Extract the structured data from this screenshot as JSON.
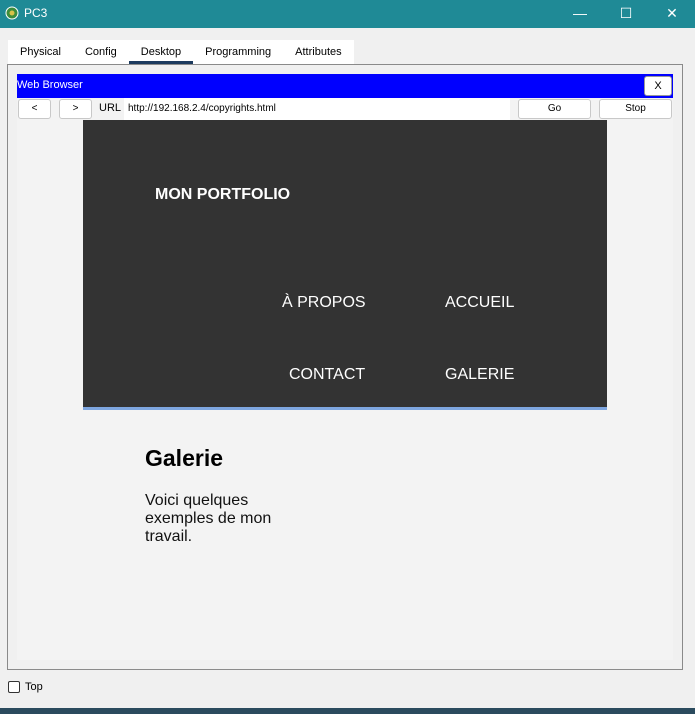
{
  "window": {
    "title": "PC3",
    "min_glyph": "—",
    "max_glyph": "☐",
    "close_glyph": "✕"
  },
  "tabs": [
    {
      "label": "Physical",
      "active": false
    },
    {
      "label": "Config",
      "active": false
    },
    {
      "label": "Desktop",
      "active": true
    },
    {
      "label": "Programming",
      "active": false
    },
    {
      "label": "Attributes",
      "active": false
    }
  ],
  "browser": {
    "title": "Web Browser",
    "close_label": "X",
    "back_label": "<",
    "forward_label": ">",
    "url_label": "URL",
    "url_value": "http://192.168.2.4/copyrights.html",
    "go_label": "Go",
    "stop_label": "Stop"
  },
  "page": {
    "brand": "MON PORTFOLIO",
    "menu": [
      "À PROPOS",
      "ACCUEIL",
      "CONTACT",
      "GALERIE"
    ],
    "heading": "Galerie",
    "text": "Voici quelques exemples de mon travail."
  },
  "footer": {
    "checkbox_label": "Top",
    "checked": false
  },
  "colors": {
    "titlebar": "#1f8a96",
    "browser_titlebar": "#0000ff",
    "hero_bg": "#333333",
    "hero_border": "#7ea6e0"
  }
}
